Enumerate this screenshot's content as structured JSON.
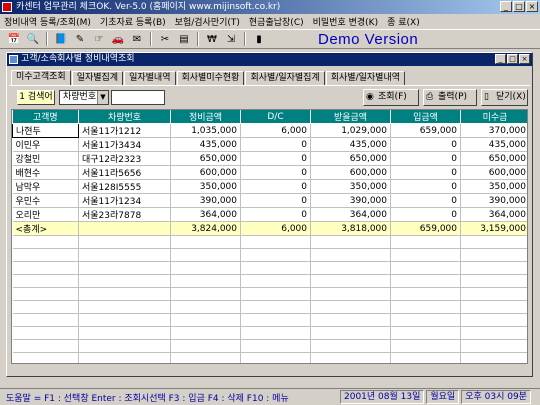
{
  "window": {
    "title": "카센터 업무관리 체크OK. Ver-5.0 (홈페이지 www.mijinsoft.co.kr)",
    "min": "_",
    "max": "□",
    "close": "×"
  },
  "menu": [
    "정비내역 등록/조회(M)",
    "기초자료 등록(B)",
    "보험/검사만기(T)",
    "현금출납장(C)",
    "비밀번호 변경(K)",
    "종 료(X)"
  ],
  "toolbar": {
    "icons": [
      "calendar-icon",
      "search-icon",
      "book-icon",
      "edit-icon",
      "hand-icon",
      "car-icon",
      "mail-icon",
      "tools-icon",
      "chart-icon",
      "money-icon",
      "exit-icon",
      "door-icon"
    ],
    "demo_label": "Demo Version"
  },
  "child_window": {
    "title": "고객/소속회사별 정비내역조회"
  },
  "tabs": [
    "미수고객조회",
    "일자별집계",
    "일자별내역",
    "회사별미수현황",
    "회사별/일자별집계",
    "회사별/일자별내역"
  ],
  "search": {
    "label": "1 검색어",
    "select_value": "차량번호",
    "select_arrow": "▼",
    "input_value": "",
    "buttons": {
      "query": "조회(F)",
      "print": "출력(P)",
      "close": "닫기(X)"
    }
  },
  "table": {
    "columns": [
      "고객명",
      "차량번호",
      "정비금액",
      "D/C",
      "받을금액",
      "입금액",
      "미수금"
    ],
    "rows": [
      [
        "나현두",
        "서울11가1212",
        "1,035,000",
        "6,000",
        "1,029,000",
        "659,000",
        "370,000"
      ],
      [
        "이민우",
        "서울11가3434",
        "435,000",
        "0",
        "435,000",
        "0",
        "435,000"
      ],
      [
        "강철민",
        "대구12라2323",
        "650,000",
        "0",
        "650,000",
        "0",
        "650,000"
      ],
      [
        "배현수",
        "서울11라5656",
        "600,000",
        "0",
        "600,000",
        "0",
        "600,000"
      ],
      [
        "남막우",
        "서울128I5555",
        "350,000",
        "0",
        "350,000",
        "0",
        "350,000"
      ],
      [
        "우민수",
        "서울11가1234",
        "390,000",
        "0",
        "390,000",
        "0",
        "390,000"
      ],
      [
        "오리만",
        "서울23라7878",
        "364,000",
        "0",
        "364,000",
        "0",
        "364,000"
      ]
    ],
    "total": [
      "<총계>",
      "",
      "3,824,000",
      "6,000",
      "3,818,000",
      "659,000",
      "3,159,000"
    ]
  },
  "status": {
    "help": "도움말 = F1 : 선택창  Enter : 조회시선택  F3 : 입금  F4 : 삭제  F10 : 메뉴",
    "date": "2001년 08월 13일",
    "weekday": "월요일",
    "time": "오후 03시 09분"
  }
}
